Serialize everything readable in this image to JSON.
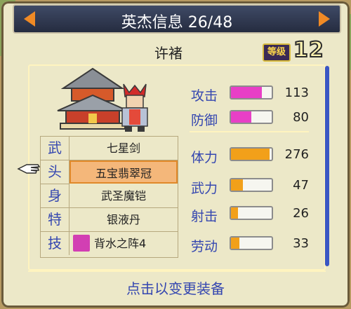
{
  "title": "英杰信息 26/48",
  "hero_name": "许褚",
  "level": {
    "label": "等级",
    "value": "12"
  },
  "equipment": [
    {
      "slot": "武",
      "item": "七星剑"
    },
    {
      "slot": "头",
      "item": "五宝翡翠冠",
      "selected": true
    },
    {
      "slot": "身",
      "item": "武圣魔铠"
    },
    {
      "slot": "特",
      "item": "银液丹"
    },
    {
      "slot": "技",
      "item": "背水之阵4",
      "icon": "skill-scroll-icon"
    }
  ],
  "stats": [
    {
      "label": "攻击",
      "value": "113",
      "fill": 0.75,
      "color": "#e83fc6"
    },
    {
      "label": "防御",
      "value": "80",
      "fill": 0.5,
      "color": "#e83fc6"
    },
    {
      "label": "体力",
      "value": "276",
      "fill": 0.95,
      "color": "#f2a01a"
    },
    {
      "label": "武力",
      "value": "47",
      "fill": 0.3,
      "color": "#f2a01a"
    },
    {
      "label": "射击",
      "value": "26",
      "fill": 0.18,
      "color": "#f2a01a"
    },
    {
      "label": "劳动",
      "value": "33",
      "fill": 0.2,
      "color": "#f2a01a"
    }
  ],
  "footer": "点击以变更装备"
}
